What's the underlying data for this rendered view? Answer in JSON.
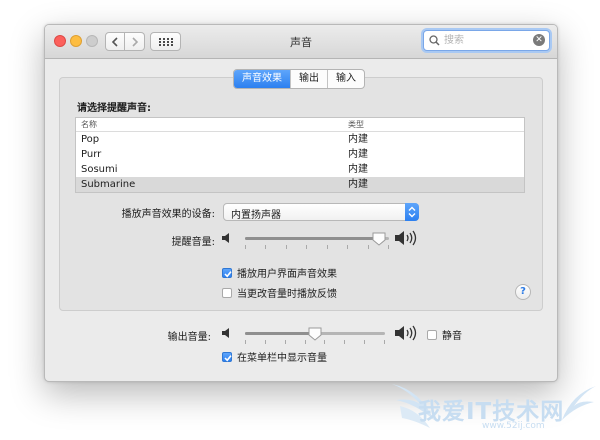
{
  "window": {
    "title": "声音"
  },
  "search": {
    "placeholder": "搜索",
    "clear_glyph": "✕"
  },
  "tabs": [
    {
      "label": "声音效果",
      "active": true
    },
    {
      "label": "输出",
      "active": false
    },
    {
      "label": "输入",
      "active": false
    }
  ],
  "alerts": {
    "choose_label": "请选择提醒声音:",
    "columns": {
      "name": "名称",
      "type": "类型"
    },
    "rows": [
      {
        "name": "Pop",
        "type": "内建",
        "selected": false
      },
      {
        "name": "Purr",
        "type": "内建",
        "selected": false
      },
      {
        "name": "Sosumi",
        "type": "内建",
        "selected": false
      },
      {
        "name": "Submarine",
        "type": "内建",
        "selected": true
      }
    ]
  },
  "device": {
    "label": "播放声音效果的设备:",
    "value": "内置扬声器"
  },
  "alert_volume": {
    "label": "提醒音量:",
    "level": 0.93
  },
  "options": {
    "ui_sounds": {
      "label": "播放用户界面声音效果",
      "checked": true
    },
    "feedback": {
      "label": "当更改音量时播放反馈",
      "checked": false
    }
  },
  "help": {
    "glyph": "?"
  },
  "output": {
    "label": "输出音量:",
    "level": 0.5,
    "mute": {
      "label": "静音",
      "checked": false
    },
    "show_in_menu": {
      "label": "在菜单栏中显示音量",
      "checked": true
    }
  },
  "watermark": {
    "text": "我爱IT技术网",
    "url": "www.52ij.com"
  },
  "colors": {
    "accent": "#2c80f0",
    "selected_row": "#d9d9d9",
    "window_bg": "#ebebeb"
  }
}
